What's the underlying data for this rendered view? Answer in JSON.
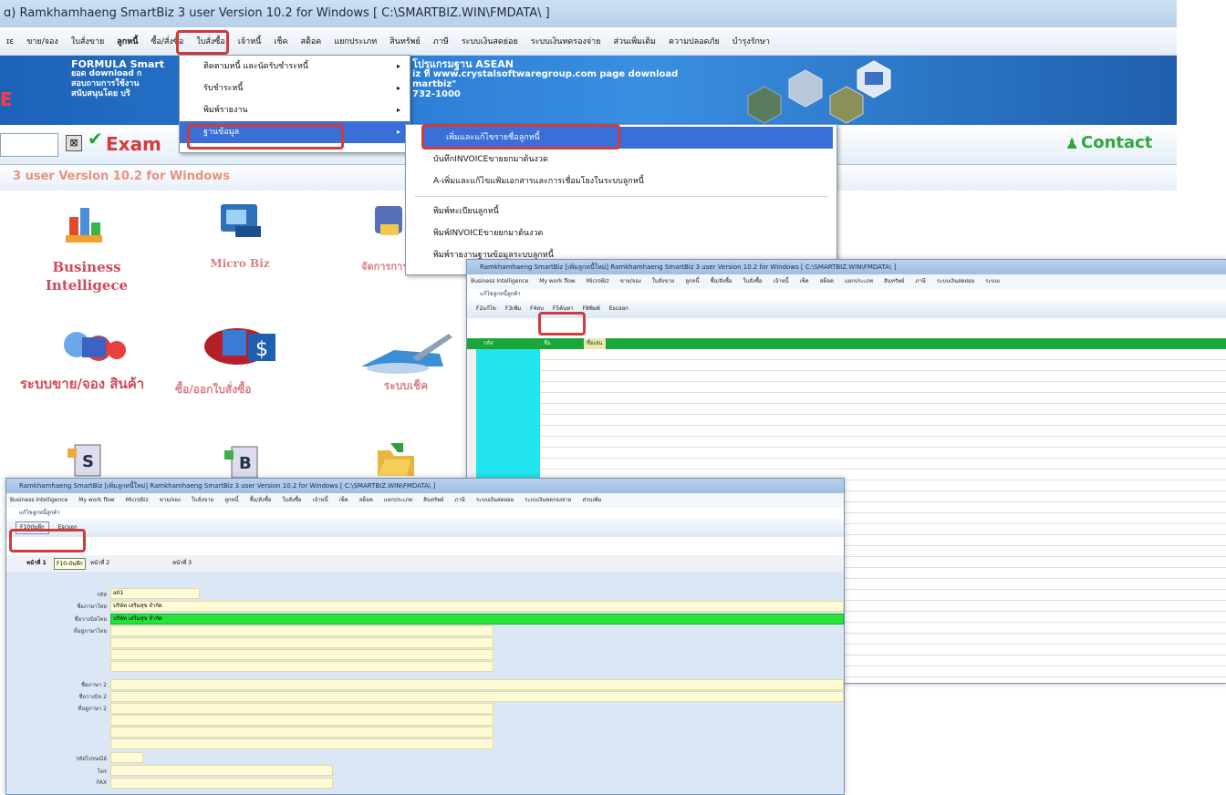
{
  "main": {
    "title": "ɑ) Ramkhamhaeng SmartBiz 3 user Version 10.2 for Windows [ C:\\SMARTBIZ.WIN\\FMDATA\\ ]",
    "menu": [
      "ɪɛ",
      "ขาย/จอง",
      "ใบสั่งขาย",
      "ลูกหนี้",
      "ซื้อ/สั่งซื้อ",
      "ใบสั่งซื้อ",
      "เจ้าหนี้",
      "เช็ค",
      "สต็อค",
      "แยกประเภท",
      "สินทรัพย์",
      "ภาษี",
      "ระบบเงินสดย่อย",
      "ระบบเงินทดรองจ่าย",
      "ส่วนเพิ่มเติม",
      "ความปลอดภัย",
      "บำรุงรักษา"
    ],
    "banner_lines": [
      "FORMULA Smart",
      "ยอด download ก",
      "สอบถามการใช้งาน",
      "สนับสนุนโดย บริ"
    ],
    "banner_right": [
      "โปรแกรมฐาน ASEAN",
      "iz ที่ www.crystalsoftwaregroup.com page download",
      "martbiz\"",
      "732-1000"
    ],
    "example_label": "Exam",
    "contact_label": "Contact",
    "version_text": "3 user Version 10.2 for Windows",
    "left_edge_char": "E",
    "modules": {
      "business": "Business Intelligece",
      "microbiz": "Micro Biz",
      "hidden_mod": "จัดการการ",
      "sales": "ระบบขาย/จอง สินค้า",
      "purchase": "ซื้อ/ออกใบสั่งซื้อ",
      "cheque": "ระบบเช็ค"
    }
  },
  "dropdown1": {
    "items": [
      {
        "label": "ติดตามหนี้ และนัดรับชำระหนี้",
        "arrow": "▸"
      },
      {
        "label": "รับชำระหนี้",
        "arrow": "▸"
      },
      {
        "label": "พิมพ์รายงาน",
        "arrow": "▸"
      },
      {
        "label": "ฐานข้อมูล",
        "arrow": "▸"
      }
    ]
  },
  "dropdown2": {
    "items": [
      "เพิ่มและแก้ไขรายชื่อลูกหนี้",
      "บันทึกINVOICEขายยกมาต้นงวด",
      "A-เพิ่มและแก้ไขแฟ้มเอกสารและการเชื่อมโยงในระบบลูกหนี้",
      "พิมพ์ทะเบียนลูกหนี้",
      "พิมพ์INVOICEขายยกมาต้นงวด",
      "พิมพ์รายงานฐานข้อมูลระบบลูกหนี้"
    ]
  },
  "win2": {
    "title": "Ramkhamhaeng SmartBiz [เพิ่มลูกหนี้ใหม่] Ramkhamhaeng SmartBiz 3 user Version 10.2 for Windows [ C:\\SMARTBIZ.WIN\\FMDATA\\ ]",
    "menu": [
      "Business Intelligence",
      "My work flow",
      "MicroBiz",
      "ขาย/จอง",
      "ใบสั่งขาย",
      "ลูกหนี้",
      "ซื้อ/สั่งซื้อ",
      "ใบสั่งซื้อ",
      "เจ้าหนี้",
      "เช็ค",
      "สต็อค",
      "แยกประเภท",
      "สินทรัพย์",
      "ภาษี",
      "ระบบเงินสดย่อย",
      "ระบบเ"
    ],
    "sub": "แก้ไขลูกหนี้ลูกค้า",
    "toolbar": [
      "F2แก้ไข",
      "F3เพิ่ม",
      "F4ลบ",
      "F5ค้นหา",
      "F8พิมพ์",
      "Escออก"
    ],
    "grid_headers": [
      "รหัส",
      "ชื่อ",
      "ชื่อเล่น"
    ]
  },
  "win3": {
    "title": "Ramkhamhaeng SmartBiz [เพิ่มลูกหนี้ใหม่] Ramkhamhaeng SmartBiz 3 user Version 10.2 for Windows [ C:\\SMARTBIZ.WIN\\FMDATA\\ ]",
    "menu": [
      "Business Intelligence",
      "My work flow",
      "MicroBiz",
      "ขาย/จอง",
      "ใบสั่งขาย",
      "ลูกหนี้",
      "ซื้อ/สั่งซื้อ",
      "ใบสั่งซื้อ",
      "เจ้าหนี้",
      "เช็ค",
      "สต็อค",
      "แยกประเภท",
      "สินทรัพย์",
      "ภาษี",
      "ระบบเงินสดย่อย",
      "ระบบเงินทดรองจ่าย",
      "ส่วนเพิ่ม"
    ],
    "sub": "แก้ไขลูกหนี้ลูกค้า",
    "toolbar": [
      "F10บันทึก",
      "Escออก"
    ],
    "tabs": [
      "หน้าที่ 1",
      "F10-บันทึก",
      "หน้าที่ 2",
      "หน้าที่ 3"
    ],
    "fields": {
      "code_label": "รหัส",
      "code_value": "a01",
      "name_th_label": "ชื่อภาษาไทย",
      "name_th_value": "บริษัท เสริมสุข จำกัด",
      "bill_th_label": "ชื่อวางบิลไทย",
      "bill_th_value": "บริษัท เสริมสุข จำกัด",
      "addr_th_label": "ที่อยู่ภาษาไทย",
      "name2_label": "ชื่อภาษา 2",
      "bill2_label": "ชื่อวางบิล 2",
      "addr2_label": "ที่อยู่ภาษา 2",
      "zip_label": "รหัสไปรษณีย์",
      "tel_label": "โทร",
      "fax_label": "FAX"
    }
  },
  "colors": {
    "highlight_red": "#d23b3b",
    "grid_cyan": "#22e4ee",
    "green_field": "#27e23a",
    "input_yellow": "#fffbd5"
  }
}
